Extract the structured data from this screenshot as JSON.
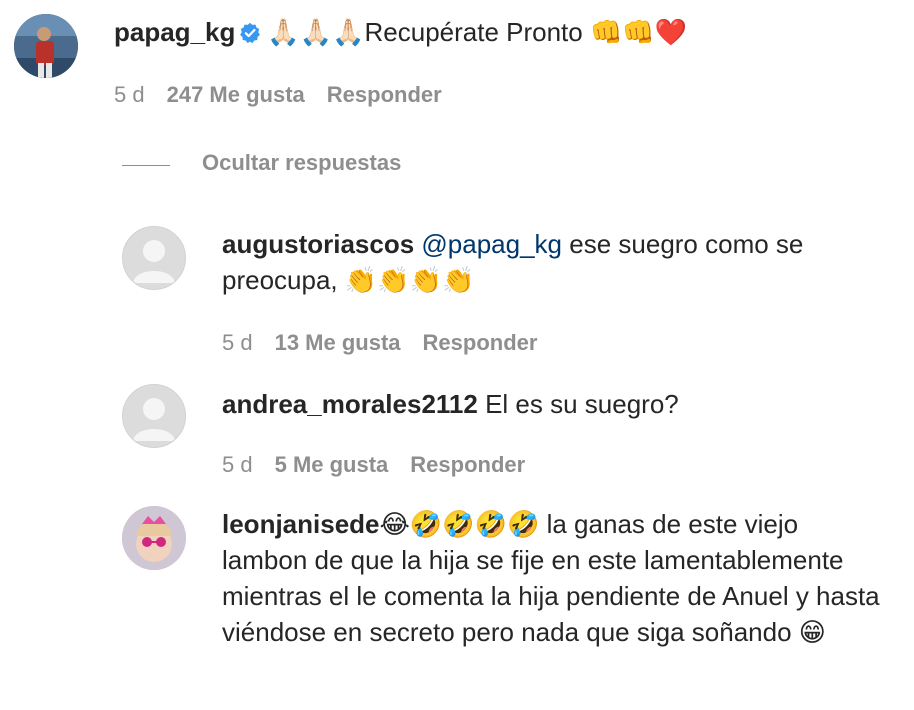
{
  "main_comment": {
    "username": "papag_kg",
    "text_emoji_prefix": "🙏🏻🙏🏻🙏🏻",
    "text": "Recupérate Pronto ",
    "text_emoji_suffix": "👊👊❤️",
    "time": "5 d",
    "likes": "247 Me gusta",
    "reply_label": "Responder",
    "verified_icon": "verified-badge-icon"
  },
  "hide_replies_label": "Ocultar respuestas",
  "replies": [
    {
      "username": "augustoriascos",
      "mention": "@papag_kg",
      "text": " ese suegro como se preocupa, ",
      "emoji": "👏👏👏👏",
      "time": "5 d",
      "likes": "13 Me gusta",
      "reply_label": "Responder"
    },
    {
      "username": "andrea_morales2112",
      "text": " El es su suegro?",
      "time": "5 d",
      "likes": "5 Me gusta",
      "reply_label": "Responder"
    },
    {
      "username": "leonjanisede",
      "emoji_prefix": " 😂🤣🤣🤣🤣",
      "text": " la ganas de este viejo lambon de que la hija se fije en este lamentablemente mientras el le comenta la hija pendiente de Anuel y hasta viéndose en secreto pero nada que siga soñando ",
      "emoji_suffix": "😁"
    }
  ],
  "colors": {
    "text": "#262626",
    "meta": "#8e8e8e",
    "mention": "#00376b",
    "verified": "#3897f0"
  }
}
